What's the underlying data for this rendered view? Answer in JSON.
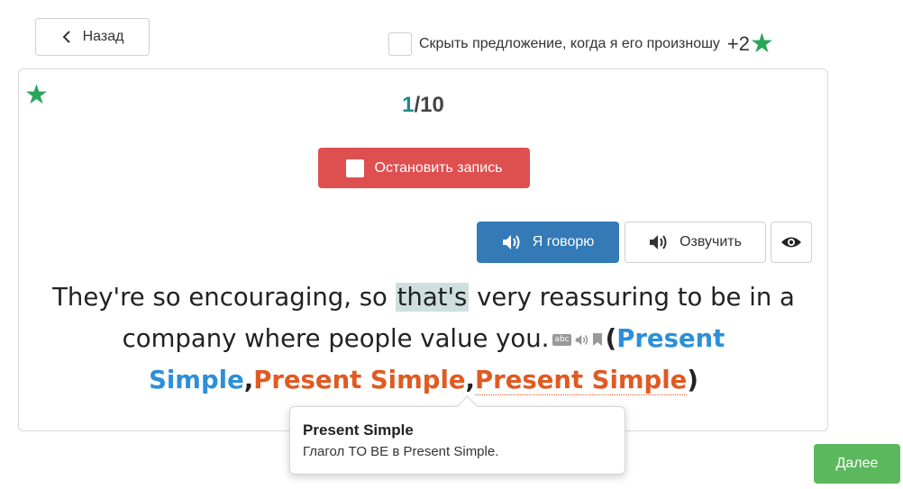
{
  "nav": {
    "back_label": "Назад"
  },
  "options": {
    "hide_sentence_label": "Скрыть предложение, когда я его произношу",
    "bonus": "+2"
  },
  "card": {
    "counter_current": "1",
    "counter_total": "/10",
    "stop_record_label": "Остановить запись",
    "speak_label": "Я говорю",
    "voice_label": "Озвучить",
    "sentence": {
      "before": "They're so encouraging, so ",
      "highlight": "that's",
      "after": " very reassuring to be in a company where people value you.",
      "mini_icon_abc": "abc",
      "tags": [
        "Present Simple",
        "Present Simple",
        "Present Simple"
      ],
      "tag_colors": [
        "#2c8fd8",
        "#e05a22",
        "#e05a22"
      ]
    }
  },
  "popover": {
    "title": "Present Simple",
    "body": "Глагол TO BE в Present Simple."
  },
  "next_label": "Далее",
  "colors": {
    "accent_blue": "#337ab7",
    "stop_red": "#de5050",
    "next_green": "#5cb85c",
    "star_green": "#2aa55a"
  },
  "icons": [
    "chevron-left-icon",
    "star-icon",
    "speaker-icon",
    "eye-icon",
    "abc-icon",
    "bookmark-icon"
  ]
}
